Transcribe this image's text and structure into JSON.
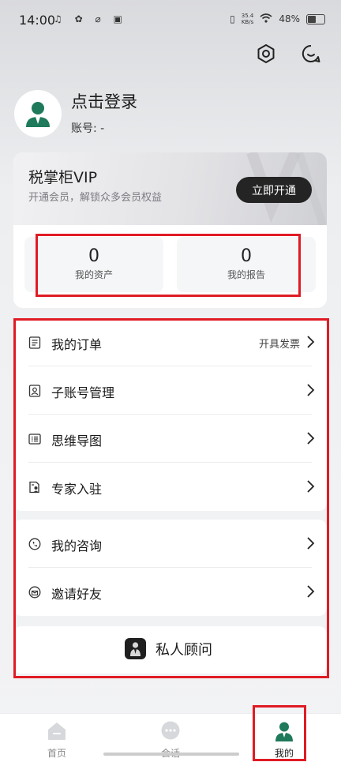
{
  "status_bar": {
    "time": "14:00",
    "speed_value": "35.4",
    "speed_unit": "KB/s",
    "battery": "48%"
  },
  "profile": {
    "login_text": "点击登录",
    "account_text": "账号: -"
  },
  "vip": {
    "title": "税掌柜VIP",
    "subtitle": "开通会员，解锁众多会员权益",
    "button": "立即开通"
  },
  "stats": [
    {
      "value": "0",
      "label": "我的资产"
    },
    {
      "value": "0",
      "label": "我的报告"
    }
  ],
  "menu_group1": [
    {
      "label": "我的订单",
      "extra": "开具发票"
    },
    {
      "label": "子账号管理"
    },
    {
      "label": "思维导图"
    },
    {
      "label": "专家入驻"
    }
  ],
  "menu_group2": [
    {
      "label": "我的咨询"
    },
    {
      "label": "邀请好友"
    }
  ],
  "advisor": {
    "label": "私人顾问"
  },
  "nav": [
    {
      "label": "首页"
    },
    {
      "label": "会话"
    },
    {
      "label": "我的"
    }
  ],
  "colors": {
    "accent_green": "#1e7a5a",
    "annotation_red": "#e01b24"
  }
}
